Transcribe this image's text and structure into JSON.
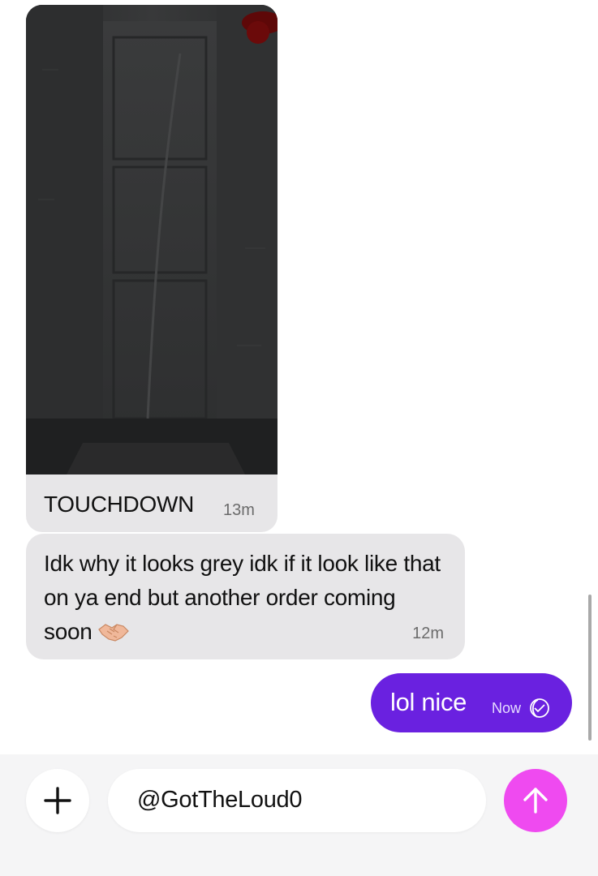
{
  "conversation": {
    "messages": [
      {
        "direction": "incoming",
        "type": "image",
        "image_description": "dark photo of a tall narrow object in packaging",
        "caption": "TOUCHDOWN",
        "time": "13m"
      },
      {
        "direction": "incoming",
        "type": "text",
        "text": "Idk why it looks grey idk if it look like that on ya end but another order coming soon",
        "emoji": "handshake-icon",
        "time": "12m"
      },
      {
        "direction": "outgoing",
        "type": "text",
        "text": "lol nice",
        "time": "Now",
        "status_icon": "read-receipt-icon"
      }
    ]
  },
  "composer": {
    "add_icon": "plus-icon",
    "input_value": "@GotTheLoud0",
    "send_icon": "arrow-up-icon"
  },
  "colors": {
    "incoming_bubble": "#e7e6e8",
    "outgoing_bubble": "#6a21e0",
    "send_button": "#ef4af0",
    "background": "#ffffff"
  }
}
